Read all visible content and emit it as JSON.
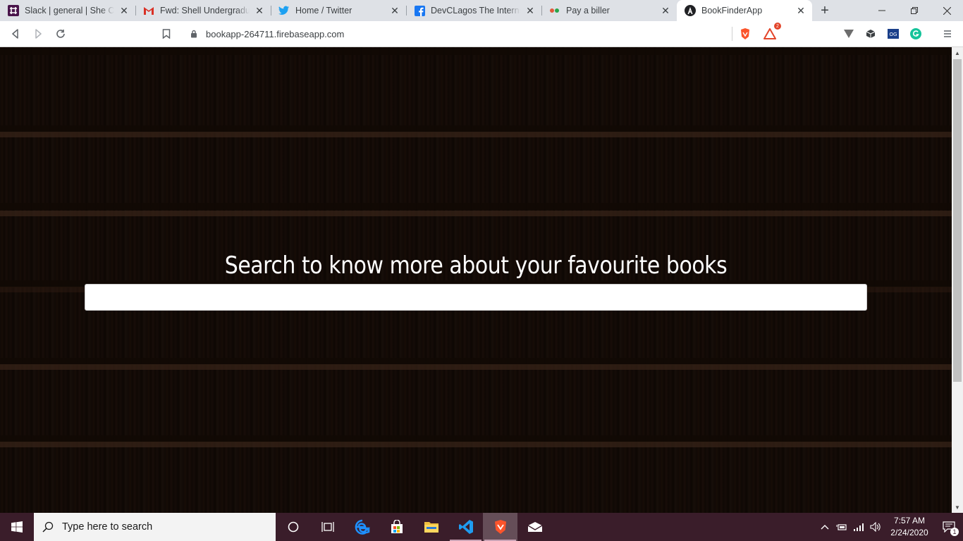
{
  "browser": {
    "tabs": [
      {
        "title": "Slack | general | She Code",
        "icon": "slack-icon"
      },
      {
        "title": "Fwd: Shell Undergraduate",
        "icon": "gmail-icon"
      },
      {
        "title": "Home / Twitter",
        "icon": "twitter-icon"
      },
      {
        "title": "DevCLagos The Internship",
        "icon": "facebook-icon"
      },
      {
        "title": "Pay a biller",
        "icon": "bank-icon"
      },
      {
        "title": "BookFinderApp",
        "icon": "angular-icon",
        "active": true
      }
    ],
    "url": "bookapp-264711.firebaseapp.com",
    "brave_rewards_badge": "2"
  },
  "page": {
    "heading": "Search to know more about your favourite books",
    "search_value": "",
    "search_placeholder": ""
  },
  "taskbar": {
    "search_placeholder": "Type here to search",
    "time": "7:57 AM",
    "date": "2/24/2020",
    "notification_count": "1"
  },
  "colors": {
    "taskbar_bg": "#3a1d2a",
    "tabstrip_bg": "#dee1e6",
    "brave_orange": "#fb542b"
  }
}
